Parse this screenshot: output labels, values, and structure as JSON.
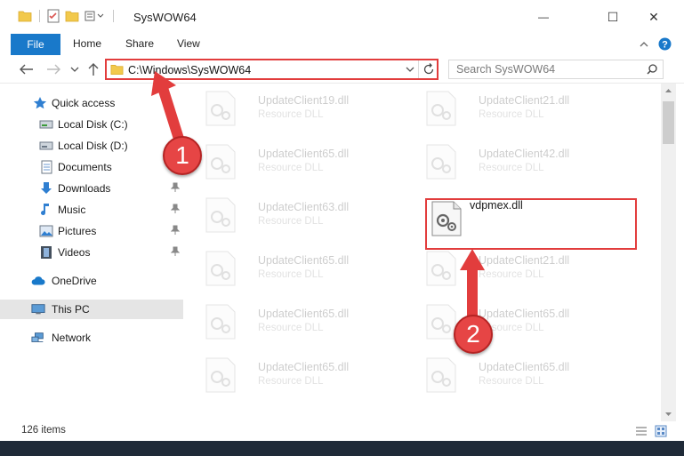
{
  "window": {
    "title": "SysWOW64",
    "minimize_glyph": "—",
    "maximize_glyph": "☐",
    "close_glyph": "✕"
  },
  "ribbon": {
    "file": "File",
    "home": "Home",
    "share": "Share",
    "view": "View"
  },
  "address": {
    "path": "C:\\Windows\\SysWOW64",
    "search_placeholder": "Search SysWOW64"
  },
  "sidebar": {
    "quick_access": "Quick access",
    "local_c": "Local Disk (C:)",
    "local_d": "Local Disk (D:)",
    "documents": "Documents",
    "downloads": "Downloads",
    "music": "Music",
    "pictures": "Pictures",
    "videos": "Videos",
    "onedrive": "OneDrive",
    "this_pc": "This PC",
    "network": "Network"
  },
  "files": {
    "r0c0": {
      "name": "UpdateClient19.dll",
      "type": "Resource DLL"
    },
    "r0c1": {
      "name": "UpdateClient21.dll",
      "type": "Resource DLL"
    },
    "r1c0": {
      "name": "UpdateClient65.dll",
      "type": "Resource DLL"
    },
    "r1c1": {
      "name": "UpdateClient42.dll",
      "type": "Resource DLL"
    },
    "r2c0": {
      "name": "UpdateClient63.dll",
      "type": "Resource DLL"
    },
    "r2c1": {
      "name": "vdpmex.dll",
      "type": ""
    },
    "r3c0": {
      "name": "UpdateClient65.dll",
      "type": "Resource DLL"
    },
    "r3c1": {
      "name": "UpdateClient21.dll",
      "type": "Resource DLL"
    },
    "r4c0": {
      "name": "UpdateClient65.dll",
      "type": "Resource DLL"
    },
    "r4c1": {
      "name": "UpdateClient65.dll",
      "type": "Resource DLL"
    },
    "r5c0": {
      "name": "UpdateClient65.dll",
      "type": "Resource DLL"
    },
    "r5c1": {
      "name": "UpdateClient65.dll",
      "type": "Resource DLL"
    }
  },
  "status": {
    "items": "126 items"
  },
  "annotations": {
    "step1": "1",
    "step2": "2"
  },
  "colors": {
    "accent": "#1979ca",
    "highlight": "#e23d3d"
  }
}
